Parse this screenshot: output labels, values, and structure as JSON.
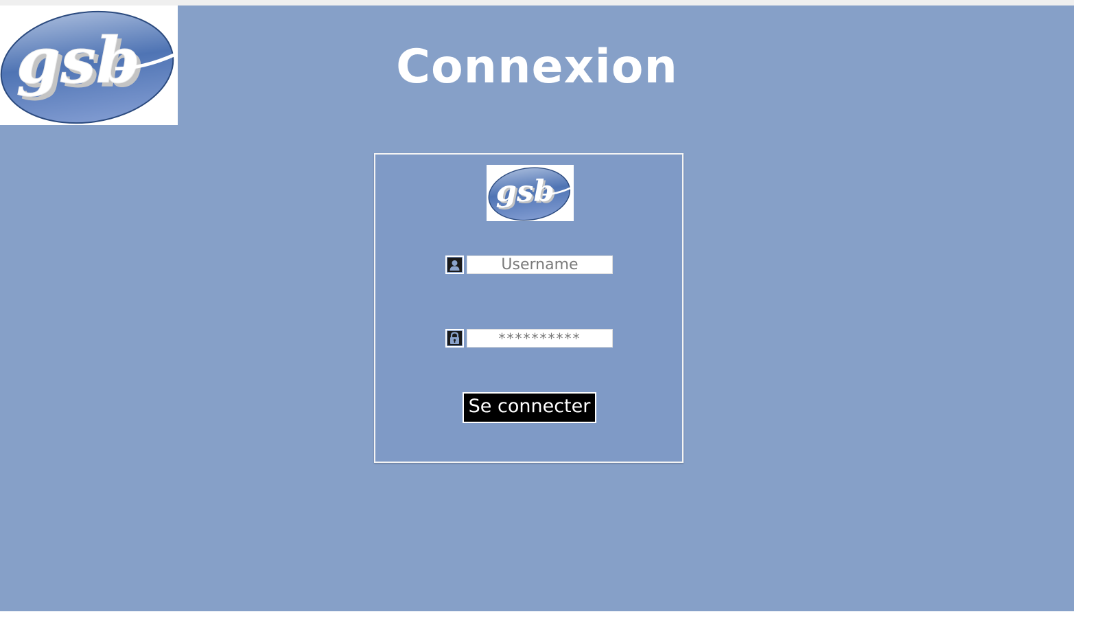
{
  "page": {
    "title": "Connexion",
    "background_color": "#86a0c8"
  },
  "logo": {
    "text": "gsb",
    "icon": "gsb-logo"
  },
  "login_form": {
    "logo_text": "gsb",
    "username": {
      "icon": "user-icon",
      "placeholder": "Username",
      "value": ""
    },
    "password": {
      "icon": "lock-icon",
      "placeholder": "**********",
      "value": ""
    },
    "submit_label": "Se connecter"
  },
  "colors": {
    "card": "#7f9ac6",
    "button": "#000000",
    "text": "#ffffff"
  }
}
